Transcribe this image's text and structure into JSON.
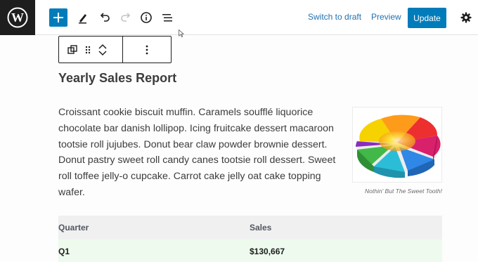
{
  "toolbar": {
    "logo_icon": "wordpress-icon",
    "add_icon": "plus-icon",
    "tools_icon": "pencil-icon",
    "undo_icon": "undo-icon",
    "redo_icon": "redo-icon",
    "info_icon": "info-icon",
    "outline_icon": "list-view-icon",
    "switch_to_draft": "Switch to draft",
    "preview": "Preview",
    "update": "Update",
    "settings_icon": "gear-icon"
  },
  "block_toolbar": {
    "transform_icon": "block-transform-icon",
    "drag_icon": "drag-handle-icon",
    "move_up_icon": "chevron-up-icon",
    "move_down_icon": "chevron-down-icon",
    "options_icon": "more-vertical-icon"
  },
  "post": {
    "title": "Yearly Sales Report",
    "paragraph": "Croissant cookie biscuit muffin. Caramels soufflé liquorice chocolate bar danish lollipop. Icing fruitcake dessert macaroon tootsie roll jujubes. Donut bear claw powder brownie dessert. Donut pastry sweet roll candy canes tootsie roll dessert. Sweet roll toffee jelly-o cupcake. Carrot cake jelly oat cake topping wafer.",
    "image_caption": "Nothin' But The Sweet Tooth!"
  },
  "table": {
    "headers": [
      "Quarter",
      "Sales"
    ],
    "rows": [
      [
        "Q1",
        "$130,667"
      ]
    ]
  },
  "colors": {
    "accent": "#007cba",
    "logo_bg": "#1e1e1e",
    "link": "#2271b1"
  }
}
